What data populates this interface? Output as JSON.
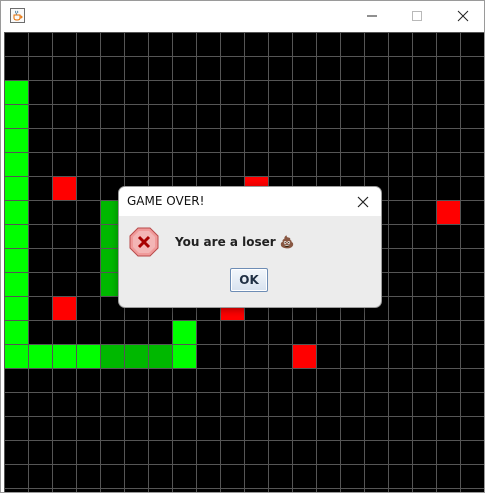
{
  "window": {
    "title": "",
    "app_icon": "java-coffee-cup-icon",
    "controls": [
      "minimize-icon",
      "maximize-icon",
      "close-icon"
    ]
  },
  "board": {
    "background": "#000000",
    "grid_color": "#555555",
    "cell_size": 24,
    "columns": 20,
    "rows": 19,
    "snake_color": "#00ff00",
    "snake_color_dim": "#00b800",
    "food_color": "#ff0000",
    "snake": [
      [
        0,
        2
      ],
      [
        0,
        3
      ],
      [
        0,
        4
      ],
      [
        0,
        5
      ],
      [
        0,
        6
      ],
      [
        0,
        7
      ],
      [
        0,
        8
      ],
      [
        0,
        9
      ],
      [
        0,
        10
      ],
      [
        0,
        11
      ],
      [
        0,
        12
      ],
      [
        0,
        13
      ],
      [
        1,
        13
      ],
      [
        2,
        13
      ],
      [
        3,
        13
      ],
      [
        4,
        13
      ],
      [
        5,
        13
      ],
      [
        6,
        13
      ],
      [
        7,
        13
      ],
      [
        7,
        12
      ],
      [
        4,
        7
      ],
      [
        4,
        8
      ],
      [
        4,
        9
      ],
      [
        4,
        10
      ]
    ],
    "food": [
      [
        2,
        6
      ],
      [
        10,
        6
      ],
      [
        18,
        7
      ],
      [
        2,
        11
      ],
      [
        9,
        11
      ],
      [
        12,
        13
      ]
    ]
  },
  "dialog": {
    "title": "GAME OVER!",
    "message": "You are a loser 💩",
    "ok_label": "OK",
    "icon": "error-icon",
    "close_icon": "close-icon"
  }
}
